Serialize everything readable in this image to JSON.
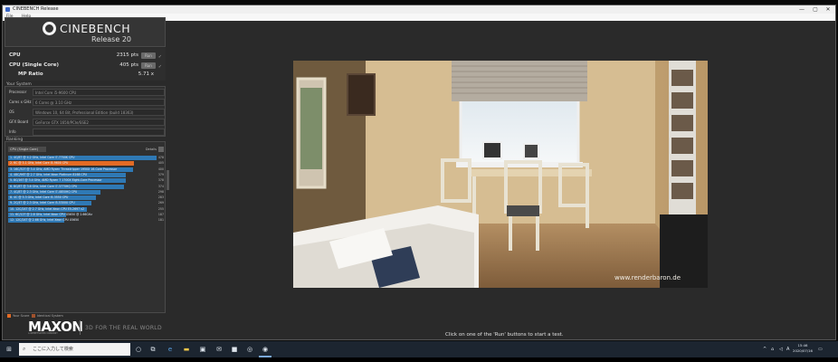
{
  "window": {
    "title": "CINEBENCH Release",
    "menu": [
      "File",
      "Help"
    ],
    "controls": [
      "—",
      "▢",
      "✕"
    ]
  },
  "logo": {
    "name": "CINEBENCH",
    "release": "Release 20"
  },
  "scores": [
    {
      "label": "CPU",
      "value": "2315 pts",
      "run": "Run"
    },
    {
      "label": "CPU (Single Core)",
      "value": "405 pts",
      "run": "Run"
    },
    {
      "label": "MP Ratio",
      "value": "5.71 x",
      "run": ""
    }
  ],
  "system": {
    "title": "Your System",
    "rows": [
      {
        "key": "Processor",
        "value": "Intel Core i5-9600 CPU"
      },
      {
        "key": "Cores x GHz",
        "value": "6 Cores @ 3.10 GHz"
      },
      {
        "key": "OS",
        "value": "Windows 10, 64 Bit, Professional Edition (build 18363)"
      },
      {
        "key": "GFX Board",
        "value": "GeForce GTX 1650/PCIe/SSE2"
      },
      {
        "key": "Info",
        "value": ""
      }
    ]
  },
  "ranking": {
    "title": "Ranking",
    "select": "CPU (Single Core)",
    "details": "Details",
    "items": [
      {
        "label": "1. 4C/8T @ 4.2 GHz, Intel Core i7-7700K CPU",
        "score": "478",
        "pct": 1.0,
        "color": "#2f79b5"
      },
      {
        "label": "2. 6C @ 3.1 GHz, Intel Core i5-9600 CPU",
        "score": "405",
        "pct": 0.85,
        "color": "#e36b25"
      },
      {
        "label": "3. 16C/32T @ 3.4 GHz, AMD Ryzen Threadripper 1950X 16-Core Processor",
        "score": "400",
        "pct": 0.84,
        "color": "#2f79b5"
      },
      {
        "label": "4. 48C/96T @ 2.7 GHz, Intel Xeon Platinum 8168 CPU",
        "score": "379",
        "pct": 0.79,
        "color": "#2f79b5"
      },
      {
        "label": "5. 8C/16T @ 3.4 GHz, AMD Ryzen 7 1700X Eight-Core Processor",
        "score": "378",
        "pct": 0.79,
        "color": "#2f79b5"
      },
      {
        "label": "6. 8C/8T @ 3.6 GHz, Intel Core i7-3770HQ CPU",
        "score": "374",
        "pct": 0.78,
        "color": "#2f79b5"
      },
      {
        "label": "7. 4C/8T @ 2.3 GHz, Intel Core i7-4850HQ CPU",
        "score": "298",
        "pct": 0.62,
        "color": "#2f79b5"
      },
      {
        "label": "8. 4C @ 3.3 GHz, Intel Core i5-3550 CPU",
        "score": "283",
        "pct": 0.59,
        "color": "#2f79b5"
      },
      {
        "label": "9. 2C/4T @ 2.3 GHz, Intel Core i5-5300U CPU",
        "score": "269",
        "pct": 0.56,
        "color": "#2f79b5"
      },
      {
        "label": "10. 12C/24T @ 2.7 GHz, Intel Xeon CPU E5-2697 v2",
        "score": "255",
        "pct": 0.53,
        "color": "#2f79b5"
      },
      {
        "label": "11. 6C/12T @ 2.8 GHz, Intel Xeon CPU X5650 @ 2.66GHz",
        "score": "187",
        "pct": 0.39,
        "color": "#2f79b5"
      },
      {
        "label": "12. 12C/24T @ 2.66 GHz, Intel Xeon CPU X5650",
        "score": "181",
        "pct": 0.38,
        "color": "#2f79b5"
      }
    ],
    "legend": [
      {
        "label": "Your Score",
        "color": "#e36b25"
      },
      {
        "label": "Identical System",
        "color": "#a0522d"
      }
    ]
  },
  "branding": {
    "maxon": "MAXON",
    "maxon_sub": "A NEMETSCHEK COMPANY",
    "tagline": "3D FOR THE REAL WORLD"
  },
  "status": "Click on one of the 'Run' buttons to start a test.",
  "render": {
    "watermark": "www.renderbaron.de"
  },
  "taskbar": {
    "search_placeholder": "ここに入力して検索",
    "time": "15:46",
    "date": "2020/07/16",
    "ime": "A"
  }
}
